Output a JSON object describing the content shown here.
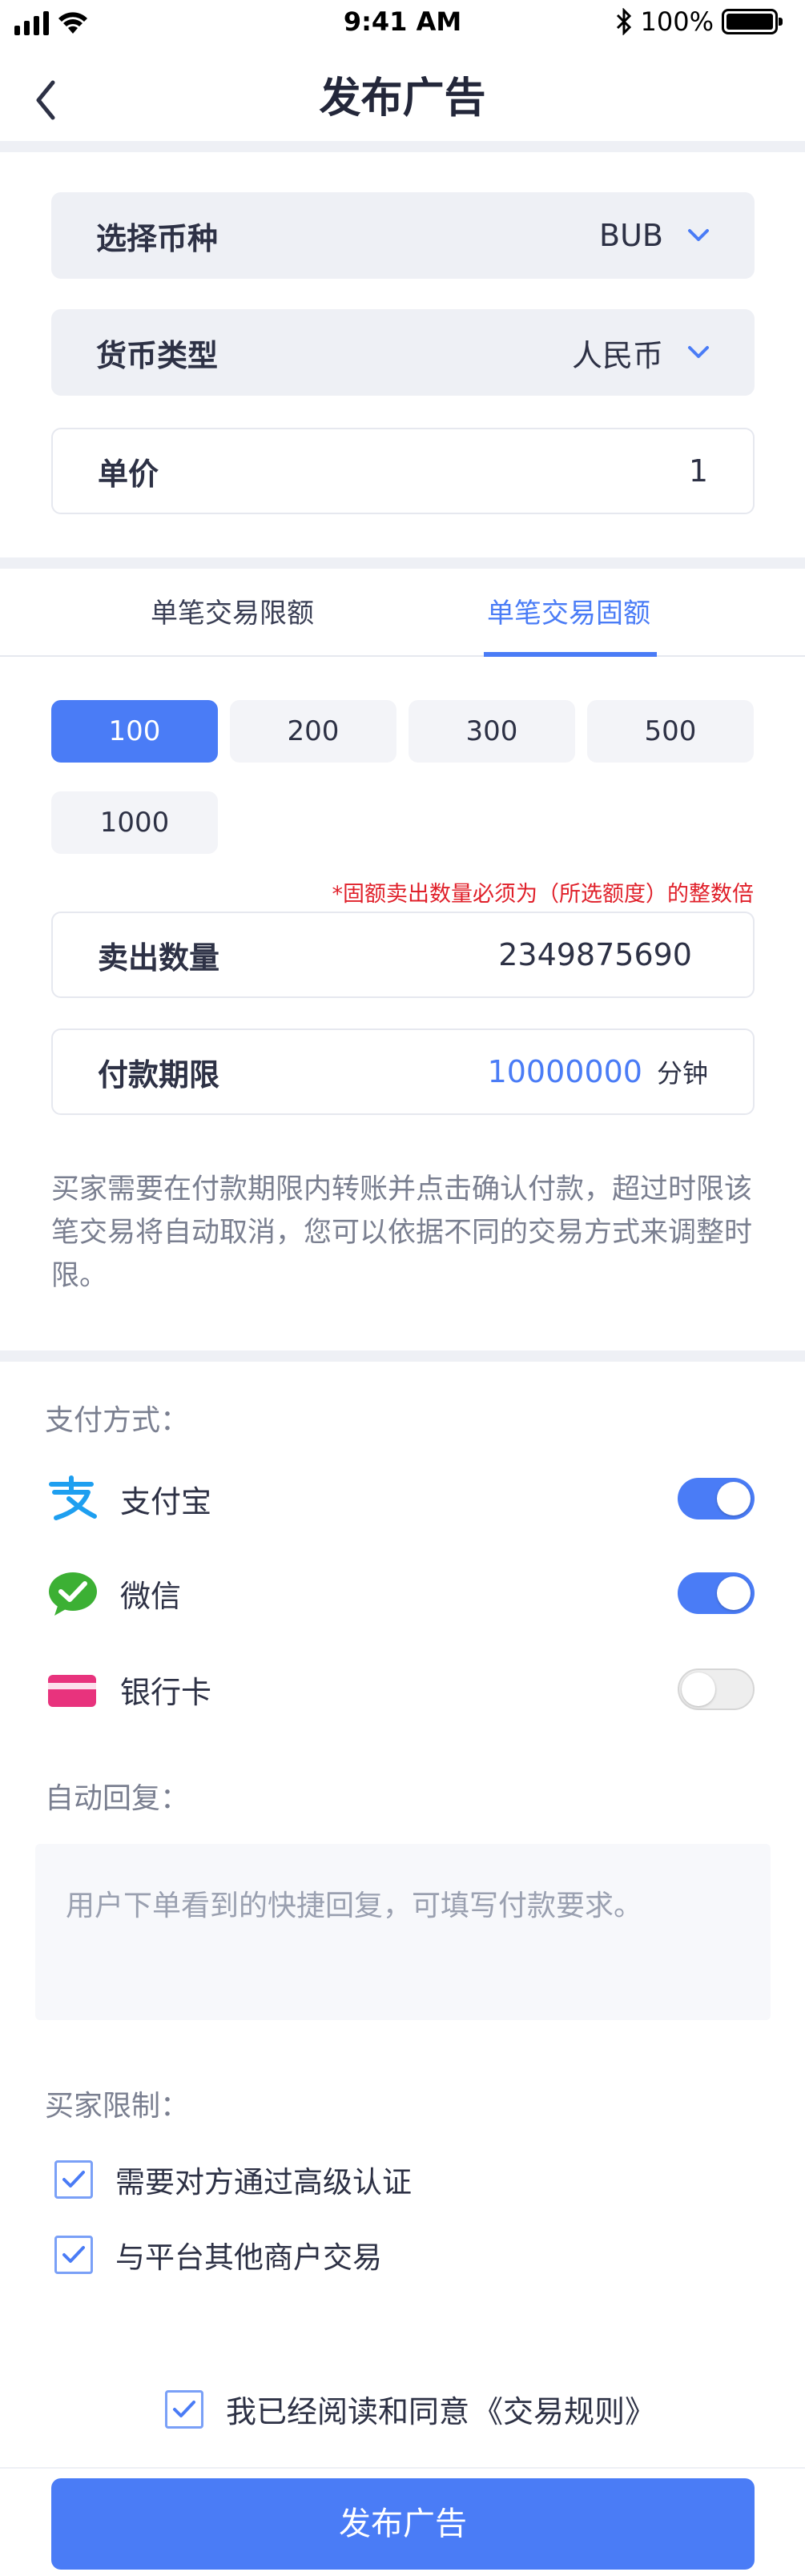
{
  "status_bar": {
    "time": "9:41 AM",
    "battery": "100%"
  },
  "nav": {
    "title": "发布广告"
  },
  "form": {
    "coin": {
      "label": "选择币种",
      "value": "BUB"
    },
    "currency": {
      "label": "货币类型",
      "value": "人民币"
    },
    "price": {
      "label": "单价",
      "value": "1"
    }
  },
  "tabs": [
    {
      "label": "单笔交易限额",
      "active": false
    },
    {
      "label": "单笔交易固额",
      "active": true
    }
  ],
  "amount_chips": [
    {
      "label": "100",
      "selected": true
    },
    {
      "label": "200",
      "selected": false
    },
    {
      "label": "300",
      "selected": false
    },
    {
      "label": "500",
      "selected": false
    },
    {
      "label": "1000",
      "selected": false
    }
  ],
  "fixed_amount_warning": "*固额卖出数量必须为（所选额度）的整数倍",
  "sell_quantity": {
    "label": "卖出数量",
    "value": "2349875690"
  },
  "payment_deadline": {
    "label": "付款期限",
    "value": "10000000",
    "unit": "分钟"
  },
  "deadline_note": "买家需要在付款期限内转账并点击确认付款，超过时限该笔交易将自动取消，您可以依据不同的交易方式来调整时限。",
  "payment_methods": {
    "label": "支付方式：",
    "items": [
      {
        "name": "支付宝",
        "icon": "alipay-icon",
        "enabled": true
      },
      {
        "name": "微信",
        "icon": "wechat-icon",
        "enabled": true
      },
      {
        "name": "银行卡",
        "icon": "bank-card-icon",
        "enabled": false
      }
    ]
  },
  "auto_reply": {
    "label": "自动回复：",
    "placeholder": "用户下单看到的快捷回复，可填写付款要求。"
  },
  "buyer_limits": {
    "label": "买家限制：",
    "items": [
      {
        "label": "需要对方通过高级认证",
        "checked": true
      },
      {
        "label": "与平台其他商户交易",
        "checked": true
      }
    ]
  },
  "agreement": {
    "text": "我已经阅读和同意",
    "link": "《交易规则》",
    "checked": true
  },
  "submit_label": "发布广告",
  "colors": {
    "accent": "#4a7cf6",
    "warning": "#e0202a",
    "alipay": "#1e9ff0",
    "wechat": "#3cb034",
    "bank_card": "#e8337d"
  }
}
